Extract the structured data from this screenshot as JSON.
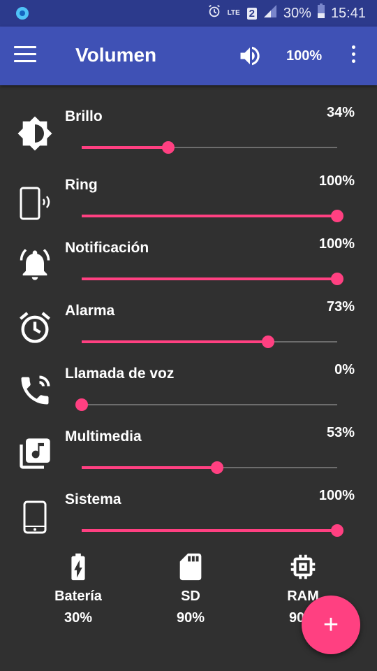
{
  "status_bar": {
    "network": "LTE",
    "sim": "2",
    "battery": "30%",
    "time": "15:41"
  },
  "app_bar": {
    "title": "Volumen",
    "volume_percent": "100%"
  },
  "controls": [
    {
      "label": "Brillo",
      "percent": "34%",
      "value": 34,
      "icon": "brightness-icon"
    },
    {
      "label": "Ring",
      "percent": "100%",
      "value": 100,
      "icon": "phone-ring-icon"
    },
    {
      "label": "Notificación",
      "percent": "100%",
      "value": 100,
      "icon": "bell-icon"
    },
    {
      "label": "Alarma",
      "percent": "73%",
      "value": 73,
      "icon": "alarm-clock-icon"
    },
    {
      "label": "Llamada de voz",
      "percent": "0%",
      "value": 0,
      "icon": "phone-call-icon"
    },
    {
      "label": "Multimedia",
      "percent": "53%",
      "value": 53,
      "icon": "music-library-icon"
    },
    {
      "label": "Sistema",
      "percent": "100%",
      "value": 100,
      "icon": "device-icon"
    }
  ],
  "stats": [
    {
      "label": "Batería",
      "value": "30%",
      "icon": "battery-charging-icon"
    },
    {
      "label": "SD",
      "value": "90%",
      "icon": "sd-card-icon"
    },
    {
      "label": "RAM",
      "value": "90%",
      "icon": "memory-chip-icon"
    }
  ],
  "fab_label": "+",
  "colors": {
    "status_bar": "#2c3a8c",
    "app_bar": "#3f51b5",
    "background": "#303030",
    "accent": "#ff4081",
    "track": "#6d6d6d"
  }
}
